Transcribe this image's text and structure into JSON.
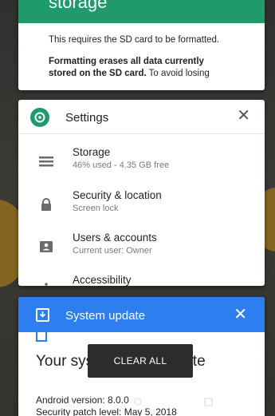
{
  "storage_card": {
    "title": "storage",
    "body_text": "This requires the SD card to be formatted.",
    "warning_bold": "Formatting erases all data currently stored on the SD card.",
    "warning_rest": " To avoid losing"
  },
  "settings_card": {
    "app_title": "Settings",
    "close_label": "✕",
    "items": [
      {
        "title": "Storage",
        "subtitle": "46% used - 4.35 GB free",
        "icon": "storage-icon"
      },
      {
        "title": "Security & location",
        "subtitle": "Screen lock",
        "icon": "lock-icon"
      },
      {
        "title": "Users & accounts",
        "subtitle": "Current user: Owner",
        "icon": "account-icon"
      },
      {
        "title": "Accessibility",
        "subtitle": "",
        "icon": "accessibility-icon"
      }
    ]
  },
  "update_card": {
    "app_title": "System update",
    "close_label": "✕",
    "heading": "Your system is up to date",
    "android_version": "Android version: 8.0.0",
    "patch_level": "Security patch level: May 5, 2018"
  },
  "clear_all_label": "CLEAR ALL",
  "nav": {
    "back": "back-icon",
    "home": "home-icon",
    "recents": "recents-icon"
  },
  "colors": {
    "settings_accent": "#1e9a6c",
    "update_accent": "#2d7ff0"
  }
}
